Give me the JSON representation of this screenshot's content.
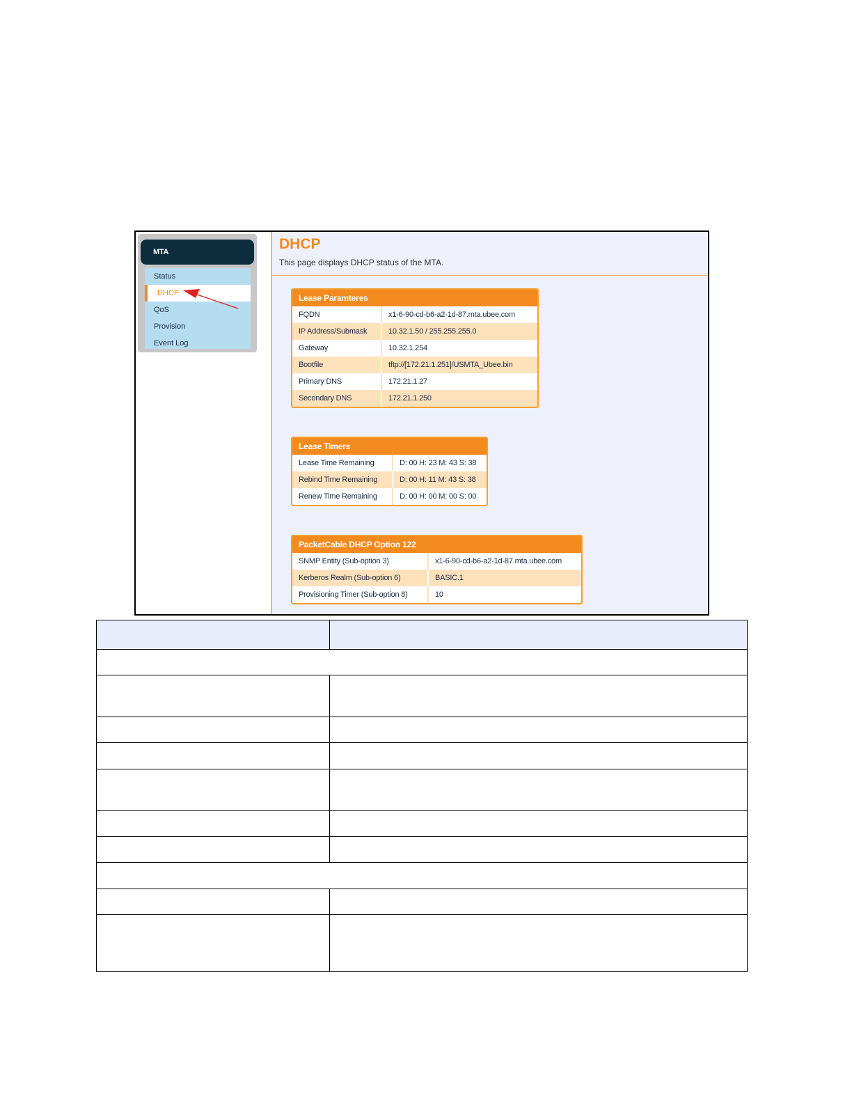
{
  "sidebar": {
    "header": "MTA",
    "items": [
      {
        "label": "Status",
        "active": false
      },
      {
        "label": "DHCP",
        "active": true
      },
      {
        "label": "QoS",
        "active": false
      },
      {
        "label": "Provision",
        "active": false
      },
      {
        "label": "Event Log",
        "active": false
      }
    ]
  },
  "page": {
    "title": "DHCP",
    "description": "This page displays DHCP status of the MTA."
  },
  "lease_parameters": {
    "title": "Lease Paramteres",
    "rows": [
      {
        "label": "FQDN",
        "value": "x1-6-90-cd-b6-a2-1d-87.mta.ubee.com"
      },
      {
        "label": "IP Address/Submask",
        "value": "10.32.1.50 / 255.255.255.0"
      },
      {
        "label": "Gateway",
        "value": "10.32.1.254"
      },
      {
        "label": "Bootfile",
        "value": "tftp://[172.21.1.251]/USMTA_Ubee.bin"
      },
      {
        "label": "Primary DNS",
        "value": "172.21.1.27"
      },
      {
        "label": "Secondary DNS",
        "value": "172.21.1.250"
      }
    ]
  },
  "lease_timers": {
    "title": "Lease Timers",
    "rows": [
      {
        "label": "Lease Time Remaining",
        "value": "D: 00 H: 23 M: 43 S: 38"
      },
      {
        "label": "Rebind Time Remaining",
        "value": "D: 00 H: 11 M: 43 S: 38"
      },
      {
        "label": "Renew Time Remaining",
        "value": "D: 00 H: 00 M: 00 S: 00"
      }
    ]
  },
  "packetcable_option": {
    "title": "PacketCable DHCP Option 122",
    "rows": [
      {
        "label": "SNMP Entity (Sub-option 3)",
        "value": "x1-6-90-cd-b6-a2-1d-87.mta.ubee.com"
      },
      {
        "label": "Kerberos Realm (Sub-option 6)",
        "value": "BASIC.1"
      },
      {
        "label": "Provisioning Timer (Sub-option 8)",
        "value": "10"
      }
    ]
  },
  "colors": {
    "accent": "#f28a1e",
    "nav_header": "#0d2d3f",
    "nav_bg": "#b6dcf0",
    "content_bg": "#eef0fb",
    "row_alt": "#fde1bb",
    "annotation_arrow": "#e02020"
  }
}
